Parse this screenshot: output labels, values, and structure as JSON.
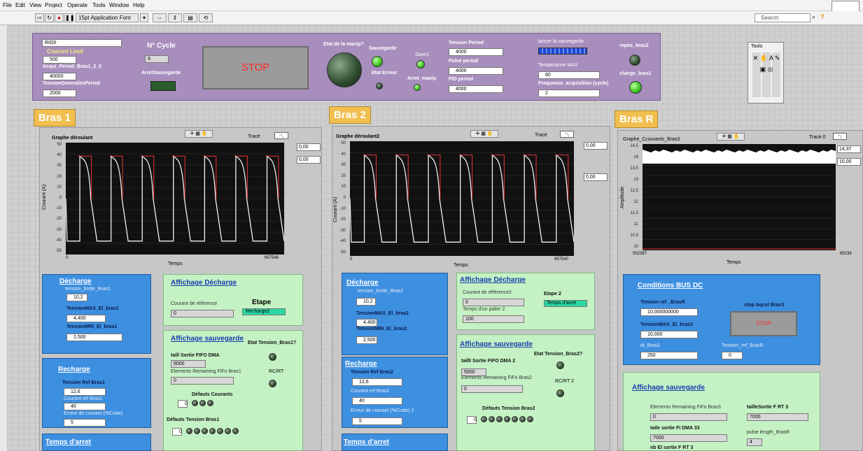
{
  "menu": [
    "File",
    "Edit",
    "View",
    "Project",
    "Operate",
    "Tools",
    "Window",
    "Help"
  ],
  "toolbar": {
    "font": "15pt Application Font",
    "search_placeholder": "Search"
  },
  "panel": {
    "resource": "RIO0",
    "courant_limit_label": "Courant Limit",
    "courant_limit": "500",
    "acqui_label": "Acqui_Period_Bras1_2_0",
    "acqui": "40000",
    "tension_gen_label": "TensionGeneralesPeriod",
    "tension_gen": "2000",
    "ncycle_label": "N° Cycle",
    "ncycle": "9",
    "arret_sauv_label": "ArretSauvegarde",
    "stop_label": "STOP",
    "etat_label": "Etat de la manip?",
    "sauvegarde_label": "Sauvegarde",
    "save1_label": "Save1",
    "etat_erreur_label": "Etat Erreur",
    "arret_manip_label": "Arret_manip",
    "tension_period_label": "Tension Period",
    "tension_period": "4000",
    "pulse_period_label": "Pulse period",
    "pulse_period": "4000",
    "pid_period_label": "PID period",
    "pid_period": "4000",
    "lancer_label": "lancer la sauvegarde",
    "temp_label": "Température MAX",
    "temp": "80",
    "freq_label": "Frequence_acquisition (cycle)",
    "freq": "2",
    "repos_label": "repos_bras2",
    "charge_label": "charge_bras1",
    "tools_label": "Tools"
  },
  "bras1": {
    "title": "Bras 1",
    "graph_title": "Graphe déroulant",
    "trace": "Tracé",
    "ylabel": "Courant (A)",
    "xlabel": "Temps",
    "x_min": "0",
    "x_max": "657546",
    "yticks": [
      "50",
      "40",
      "30",
      "20",
      "10",
      "0",
      "-10",
      "-20",
      "-30",
      "-40",
      "-50"
    ],
    "readout1": "0,00",
    "readout2": "0,00",
    "decharge_title": "Décharge",
    "tension_limite_label": "tension_limite_Bras1",
    "tension_limite": "10,2",
    "tensionmax_label": "TensionMAX_El_bras1",
    "tensionmax": "4,400",
    "tensionmin_label": "TensionMIN_El_bras1",
    "tensionmin": "2,500",
    "recharge_title": "Recharge",
    "tension_ref_label": "Tension Ref Bras1",
    "tension_ref": "12,6",
    "courant_ref_label": "Courant ref Bras1",
    "courant_ref": "40",
    "erreur_label": "Erreur de courant (%Crate)",
    "erreur": "5",
    "temps_arret_title": "Temps d'arret",
    "aff_decharge_title": "Affichage Décharge",
    "courant_reference_label": "Courant de référence",
    "courant_reference": "0",
    "etape_label": "Etape",
    "etape": "Recharge2",
    "aff_sauv_title": "Affichage sauvegarde",
    "etat_tension_label": "Etat Tension_Bras1?",
    "fifo_label": "taill Sortie FIFO DMA",
    "fifo": "6000",
    "remaining_label": "Elements Remaining FiFo Bras1",
    "remaining": "0",
    "rcrt_label": "RC/RT",
    "defauts_courants_label": "Défauts Courants",
    "defauts_tension_label": "Défauts Tension Bras1",
    "idx": "0"
  },
  "bras2": {
    "title": "Bras 2",
    "graph_title": "Graphe déroulant2",
    "trace": "Tracé",
    "ylabel": "Courant (A)",
    "xlabel": "Temps",
    "x_min": "0",
    "x_max": "657540",
    "yticks": [
      "50",
      "40",
      "30",
      "20",
      "10",
      "0",
      "-10",
      "-20",
      "-30",
      "-40",
      "-50"
    ],
    "readout1": "0,00",
    "readout2": "0,00",
    "decharge_title": "Décharge",
    "tension_limite_label": "tension_limite_Bras2",
    "tension_limite": "10,2",
    "tensionmax_label": "TensionMAX_El_bras2",
    "tensionmax": "4,400",
    "tensionmin_label": "TensionMIN_El_bras2",
    "tensionmin": "2,500",
    "recharge_title": "Recharge",
    "tension_ref_label": "Tension Ref Bras2",
    "tension_ref": "12,6",
    "courant_ref_label": "Courant ref Bras2",
    "courant_ref": "40",
    "erreur_label": "Erreur de courant (%Crate) 2",
    "erreur": "5",
    "temps_arret_title": "Temps d'arret",
    "aff_decharge_title": "Affichage Décharge",
    "courant_reference_label": "Courant de référence2",
    "courant_reference": "0",
    "etape_label": "Etape 2",
    "etape": "Temps d'arret",
    "temps_palier_label": "Temps d'un palier 2",
    "temps_palier": "100",
    "aff_sauv_title": "Affichage sauvegarde",
    "etat_tension_label": "Etat Tension_Bras2?",
    "fifo_label": "taillI Sortie FIFO DMA  2",
    "fifo": "5000",
    "remaining_label": "Elements Remaining FiFo Bras2",
    "remaining": "0",
    "rcrt_label": "RC/RT 2",
    "defauts_tension_label": "Défauts Tension Bras2",
    "idx": "0"
  },
  "brasr": {
    "title": "Bras R",
    "graph_title": "Graphe_Ccourants_Bras3",
    "trace": "Tracé 0",
    "ylabel": "Amplitude",
    "xlabel": "Temps",
    "x_min": "552387",
    "x_max": "65238",
    "yticks": [
      "14,5",
      "14",
      "13,5",
      "13",
      "12,5",
      "12",
      "11,5",
      "11",
      "10,5",
      "10"
    ],
    "readout1": "14,37",
    "readout2": "10,00",
    "bus_title": "Conditions BUS DC",
    "tension_ref_label": "Tension ref _BrasR",
    "tension_ref": "10,000000000",
    "tensionmax_label": "TensionMAX_El_bras3",
    "tensionmax": "10,000",
    "dt_label": "dt_Bras3",
    "dt": "250",
    "tension_ref_r_label": "Tension_ref_BrasR",
    "tension_ref_r": "0",
    "stop_acqui_label": "stop Aqcul Bras3",
    "stop_label": "STOP",
    "aff_sauv_title": "Affichage sauvegarde",
    "remaining_label": "Elements Remaining FiFo Bras3",
    "remaining": "0",
    "taille_rt_label": "tailleSortie F RT 3",
    "taille_rt": "7000",
    "taille_dma_label": "taile sortie Fi DMA 33",
    "taille_dma": "7000",
    "pulse_label": "pulse length_BrasR",
    "pulse": "4",
    "nb_label": "nb El sortie F RT 3"
  }
}
